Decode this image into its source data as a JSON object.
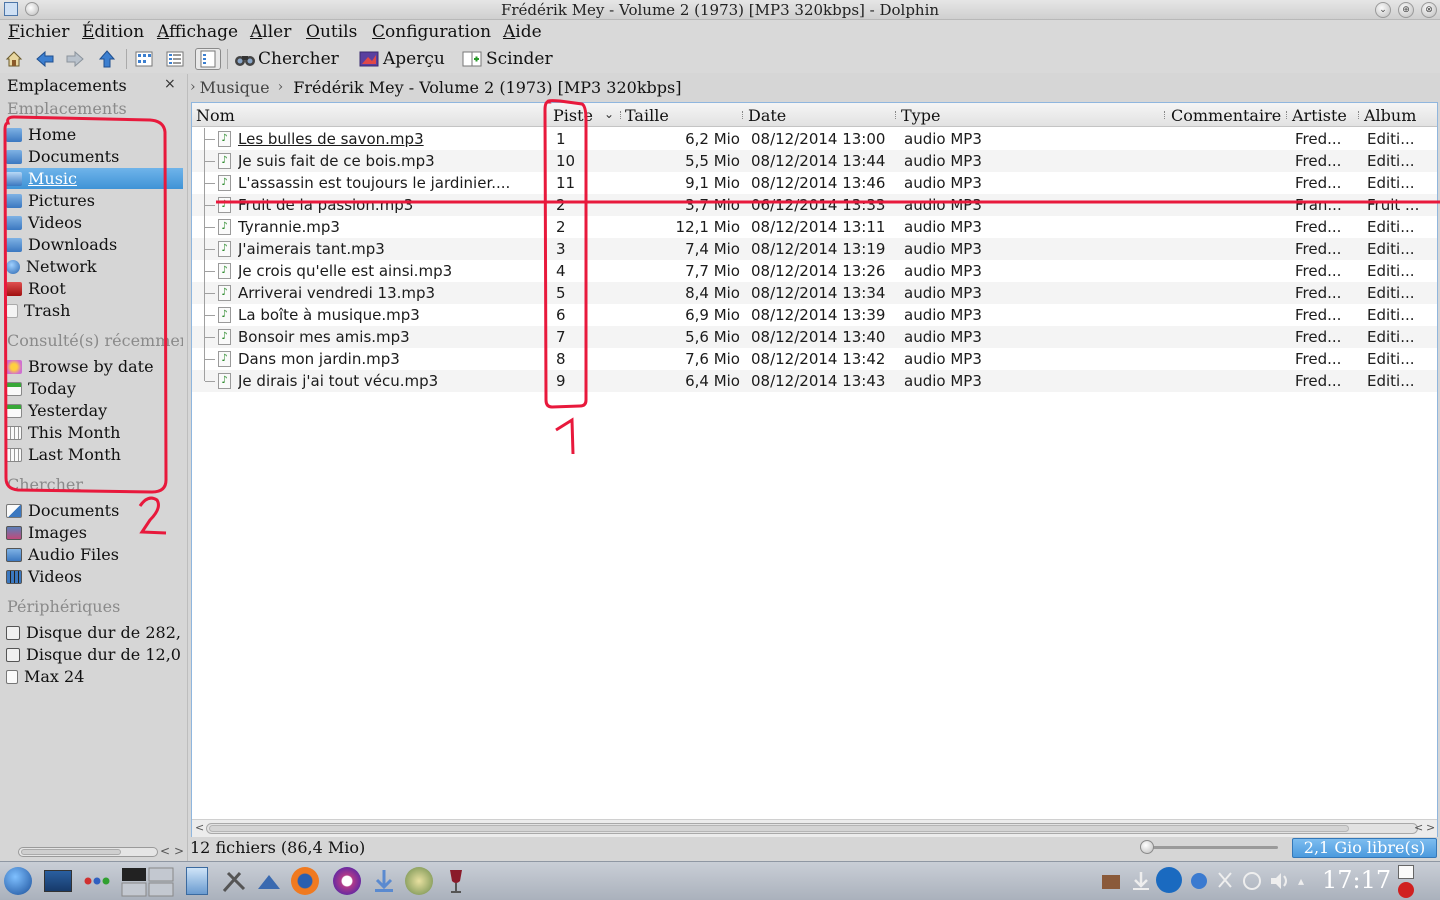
{
  "window": {
    "title": "Frédérik Mey - Volume 2 (1973) [MP3 320kbps] - Dolphin"
  },
  "menu": [
    "Fichier",
    "Édition",
    "Affichage",
    "Aller",
    "Outils",
    "Configuration",
    "Aide"
  ],
  "toolbar": {
    "search_label": "Chercher",
    "preview_label": "Aperçu",
    "split_label": "Scinder"
  },
  "places": {
    "panel_title": "Emplacements",
    "sections": {
      "places": "Emplacements",
      "recent": "Consulté(s) récemment",
      "search": "Chercher",
      "devices": "Périphériques"
    },
    "items": [
      {
        "label": "Home",
        "icon": "home-folder-icon"
      },
      {
        "label": "Documents",
        "icon": "documents-folder-icon"
      },
      {
        "label": "Music",
        "icon": "music-folder-icon",
        "selected": true
      },
      {
        "label": "Pictures",
        "icon": "pictures-folder-icon"
      },
      {
        "label": "Videos",
        "icon": "videos-folder-icon"
      },
      {
        "label": "Downloads",
        "icon": "downloads-folder-icon"
      },
      {
        "label": "Network",
        "icon": "network-icon"
      },
      {
        "label": "Root",
        "icon": "root-folder-icon"
      },
      {
        "label": "Trash",
        "icon": "trash-icon"
      }
    ],
    "recent": [
      {
        "label": "Browse by date",
        "icon": "calendar-icon"
      },
      {
        "label": "Today",
        "icon": "calendar-today-icon"
      },
      {
        "label": "Yesterday",
        "icon": "calendar-yesterday-icon"
      },
      {
        "label": "This Month",
        "icon": "calendar-month-icon"
      },
      {
        "label": "Last Month",
        "icon": "calendar-last-month-icon"
      }
    ],
    "search": [
      {
        "label": "Documents",
        "icon": "documents-search-icon"
      },
      {
        "label": "Images",
        "icon": "images-search-icon"
      },
      {
        "label": "Audio Files",
        "icon": "audio-search-icon"
      },
      {
        "label": "Videos",
        "icon": "videos-search-icon"
      }
    ],
    "devices": [
      {
        "label": "Disque dur de 282,",
        "icon": "hard-disk-icon"
      },
      {
        "label": "Disque dur de 12,0",
        "icon": "hard-disk-icon"
      },
      {
        "label": "Max 24",
        "icon": "usb-drive-icon"
      }
    ]
  },
  "breadcrumb": {
    "parent": "Musique",
    "current": "Frédérik Mey - Volume 2 (1973)  [MP3 320kbps]"
  },
  "columns": {
    "nom": "Nom",
    "piste": "Piste",
    "taille": "Taille",
    "date": "Date",
    "type": "Type",
    "commentaire": "Commentaire",
    "artiste": "Artiste",
    "album": "Album"
  },
  "files": [
    {
      "name": "Les bulles de savon.mp3",
      "track": "1",
      "size": "6,2 Mio",
      "date": "08/12/2014 13:00",
      "type": "audio MP3",
      "artist": "Fred...",
      "album": "Editi..."
    },
    {
      "name": "Je suis fait de ce bois.mp3",
      "track": "10",
      "size": "5,5 Mio",
      "date": "08/12/2014 13:44",
      "type": "audio MP3",
      "artist": "Fred...",
      "album": "Editi..."
    },
    {
      "name": "L'assassin est toujours le jardinier....",
      "track": "11",
      "size": "9,1 Mio",
      "date": "08/12/2014 13:46",
      "type": "audio MP3",
      "artist": "Fred...",
      "album": "Editi..."
    },
    {
      "name": "Fruit de la passion.mp3",
      "track": "2",
      "size": "3,7 Mio",
      "date": "06/12/2014 13:33",
      "type": "audio MP3",
      "artist": "Fran...",
      "album": "Fruit ..."
    },
    {
      "name": "Tyrannie.mp3",
      "track": "2",
      "size": "12,1 Mio",
      "date": "08/12/2014 13:11",
      "type": "audio MP3",
      "artist": "Fred...",
      "album": "Editi..."
    },
    {
      "name": "J'aimerais tant.mp3",
      "track": "3",
      "size": "7,4 Mio",
      "date": "08/12/2014 13:19",
      "type": "audio MP3",
      "artist": "Fred...",
      "album": "Editi..."
    },
    {
      "name": "Je crois qu'elle est ainsi.mp3",
      "track": "4",
      "size": "7,7 Mio",
      "date": "08/12/2014 13:26",
      "type": "audio MP3",
      "artist": "Fred...",
      "album": "Editi..."
    },
    {
      "name": "Arriverai vendredi 13.mp3",
      "track": "5",
      "size": "8,4 Mio",
      "date": "08/12/2014 13:34",
      "type": "audio MP3",
      "artist": "Fred...",
      "album": "Editi..."
    },
    {
      "name": "La boîte à musique.mp3",
      "track": "6",
      "size": "6,9 Mio",
      "date": "08/12/2014 13:39",
      "type": "audio MP3",
      "artist": "Fred...",
      "album": "Editi..."
    },
    {
      "name": "Bonsoir mes amis.mp3",
      "track": "7",
      "size": "5,6 Mio",
      "date": "08/12/2014 13:40",
      "type": "audio MP3",
      "artist": "Fred...",
      "album": "Editi..."
    },
    {
      "name": "Dans mon jardin.mp3",
      "track": "8",
      "size": "7,6 Mio",
      "date": "08/12/2014 13:42",
      "type": "audio MP3",
      "artist": "Fred...",
      "album": "Editi..."
    },
    {
      "name": "Je dirais j'ai tout vécu.mp3",
      "track": "9",
      "size": "6,4 Mio",
      "date": "08/12/2014 13:43",
      "type": "audio MP3",
      "artist": "Fred...",
      "album": "Editi..."
    }
  ],
  "status": {
    "summary": "12 fichiers (86,4 Mio)",
    "free_space": "2,1 Gio libre(s)"
  },
  "annotations": {
    "label_1": "1",
    "label_2": "2",
    "color": "#e8193c"
  },
  "taskbar": {
    "clock": "17:17"
  },
  "colors": {
    "selection": "#3f93d6",
    "annotation": "#e8193c",
    "free_space_bar": "#4b9ade"
  }
}
